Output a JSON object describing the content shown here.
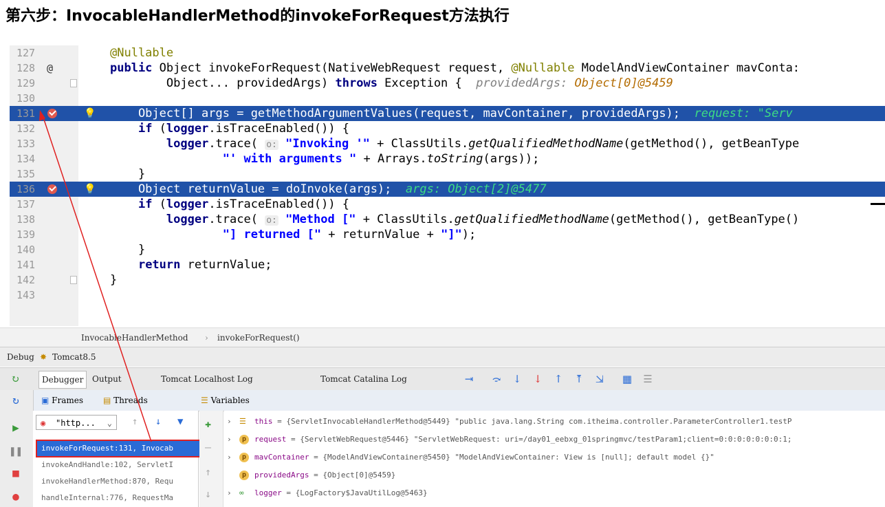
{
  "page_title": "第六步：InvocableHandlerMethod的invokeForRequest方法执行",
  "editor": {
    "lines": [
      {
        "n": "127"
      },
      {
        "n": "128",
        "mark": "@"
      },
      {
        "n": "129"
      },
      {
        "n": "130"
      },
      {
        "n": "131",
        "breakpoint": true,
        "highlight": true
      },
      {
        "n": "132"
      },
      {
        "n": "133"
      },
      {
        "n": "134"
      },
      {
        "n": "135"
      },
      {
        "n": "136",
        "breakpoint": true,
        "highlight": true
      },
      {
        "n": "137"
      },
      {
        "n": "138"
      },
      {
        "n": "139"
      },
      {
        "n": "140"
      },
      {
        "n": "141"
      },
      {
        "n": "142"
      },
      {
        "n": "143"
      }
    ],
    "code": {
      "l127_anno": "@Nullable",
      "l128_kw": "public",
      "l128_a": " Object invokeForRequest(NativeWebRequest request, ",
      "l128_anno": "@Nullable",
      "l128_b": " ModelAndViewContainer mavConta:",
      "l129_a": "        Object... providedArgs) ",
      "l129_kw": "throws",
      "l129_b": " Exception {  ",
      "l129_hint": "providedArgs: ",
      "l129_val": "Object[0]@5459",
      "l131_a": "    Object[] args = getMethodArgumentValues(request, mavContainer, providedArgs);  ",
      "l131_val": "request: \"Serv",
      "l132_kw": "if",
      "l132_a": " (",
      "l132_kw2": "logger",
      "l132_b": ".isTraceEnabled()) {",
      "l133_kw": "logger",
      "l133_a": ".trace( ",
      "l133_inlay": "o:",
      "l133_str": " \"Invoking '\"",
      "l133_b": " + ClassUtils.",
      "l133_it": "getQualifiedMethodName",
      "l133_c": "(getMethod(), getBeanType",
      "l134_str": "\"' with arguments \"",
      "l134_a": " + Arrays.",
      "l134_it": "toString",
      "l134_b": "(args));",
      "l135": "}",
      "l136_a": "    Object returnValue = doInvoke(args);  ",
      "l136_val": "args: Object[2]@5477",
      "l137_kw": "if",
      "l137_a": " (",
      "l137_kw2": "logger",
      "l137_b": ".isTraceEnabled()) {",
      "l138_kw": "logger",
      "l138_a": ".trace( ",
      "l138_inlay": "o:",
      "l138_str": " \"Method [\"",
      "l138_b": " + ClassUtils.",
      "l138_it": "getQualifiedMethodName",
      "l138_c": "(getMethod(), getBeanType()",
      "l139_str": "\"] returned [\"",
      "l139_a": " + returnValue + ",
      "l139_str2": "\"]\"",
      "l139_b": ");",
      "l140": "}",
      "l141_kw": "return",
      "l141_a": " returnValue;",
      "l142": "}"
    }
  },
  "breadcrumb": {
    "class": "InvocableHandlerMethod",
    "sep": "›",
    "method": "invokeForRequest()"
  },
  "debug_bar": {
    "label": "Debug",
    "config": "Tomcat8.5"
  },
  "tabs": [
    {
      "label": "Debugger",
      "active": true
    },
    {
      "label": "Output"
    },
    {
      "label": "Tomcat Localhost Log"
    },
    {
      "label": "Tomcat Catalina Log"
    }
  ],
  "panels": {
    "frames_label": "Frames",
    "threads_label": "Threads",
    "variables_label": "Variables"
  },
  "thread_select": {
    "value": "\"http..."
  },
  "frames": [
    {
      "label": "invokeForRequest:131, Invocab",
      "selected": true
    },
    {
      "label": "invokeAndHandle:102, ServletI"
    },
    {
      "label": "invokeHandlerMethod:870, Requ"
    },
    {
      "label": "handleInternal:776, RequestMa"
    }
  ],
  "variables": [
    {
      "name": "this",
      "value": "= {ServletInvocableHandlerMethod@5449} \"public java.lang.String com.itheima.controller.ParameterController1.testP",
      "icon": "field",
      "expand": true
    },
    {
      "name": "request",
      "value": "= {ServletWebRequest@5446} \"ServletWebRequest: uri=/day01_eebxg_01springmvc/testParam1;client=0:0:0:0:0:0:0:1;",
      "icon": "p",
      "expand": true
    },
    {
      "name": "mavContainer",
      "value": "= {ModelAndViewContainer@5450} \"ModelAndViewContainer: View is [null]; default model {}\"",
      "icon": "p",
      "expand": true
    },
    {
      "name": "providedArgs",
      "value": "= {Object[0]@5459}",
      "icon": "p",
      "expand": false
    },
    {
      "name": "logger",
      "value": "= {LogFactory$JavaUtilLog@5463}",
      "icon": "oo",
      "expand": true
    }
  ],
  "colors": {
    "highlight": "#2052a8",
    "breakpoint": "#e0594f",
    "annotation_arrow": "#e02020"
  }
}
